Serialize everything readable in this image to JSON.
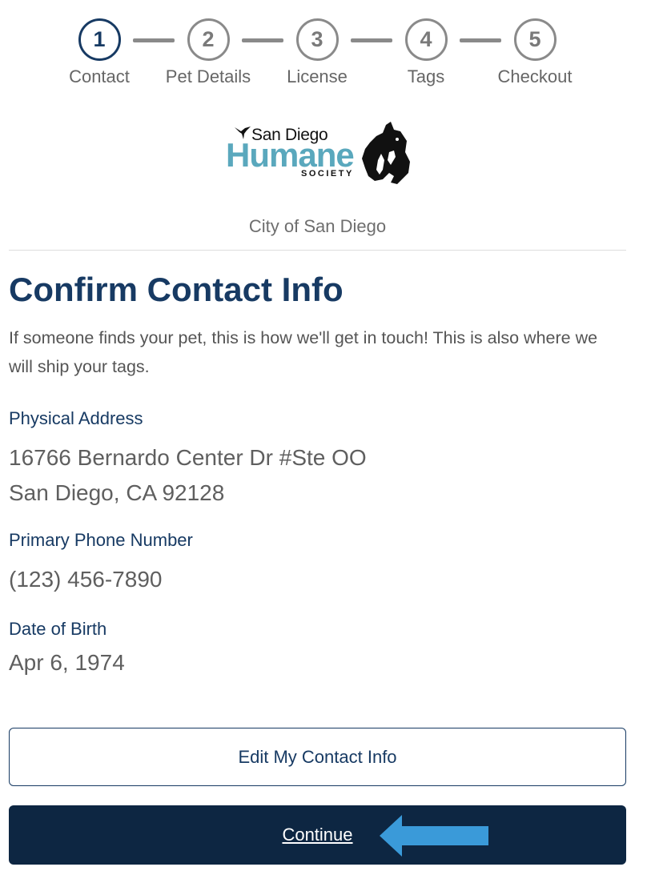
{
  "stepper": {
    "steps": [
      {
        "number": "1",
        "label": "Contact",
        "state": "active"
      },
      {
        "number": "2",
        "label": "Pet Details",
        "state": "inactive"
      },
      {
        "number": "3",
        "label": "License",
        "state": "inactive"
      },
      {
        "number": "4",
        "label": "Tags",
        "state": "inactive"
      },
      {
        "number": "5",
        "label": "Checkout",
        "state": "inactive"
      }
    ]
  },
  "logo": {
    "line1": "San Diego",
    "line2": "Humane",
    "line3": "SOCIETY"
  },
  "city": "City of San Diego",
  "page_title": "Confirm Contact Info",
  "intro": "If someone finds your pet, this is how we'll get in touch! This is also where we will ship your tags.",
  "fields": {
    "address": {
      "label": "Physical Address",
      "line1": "16766 Bernardo Center Dr #Ste OO",
      "line2": "San Diego, CA 92128"
    },
    "phone": {
      "label": "Primary Phone Number",
      "value": "(123) 456-7890"
    },
    "dob": {
      "label": "Date of Birth",
      "value": "Apr 6, 1974"
    }
  },
  "buttons": {
    "edit": "Edit My Contact Info",
    "continue": "Continue"
  },
  "colors": {
    "primary": "#173a63",
    "button_dark": "#0d2642",
    "logo_teal": "#5aa8bd",
    "arrow": "#3a9ad9"
  },
  "icons": {
    "arrow": "arrow-left-icon",
    "logo_bird": "hummingbird-icon",
    "logo_animals": "dog-cat-silhouette-icon"
  }
}
